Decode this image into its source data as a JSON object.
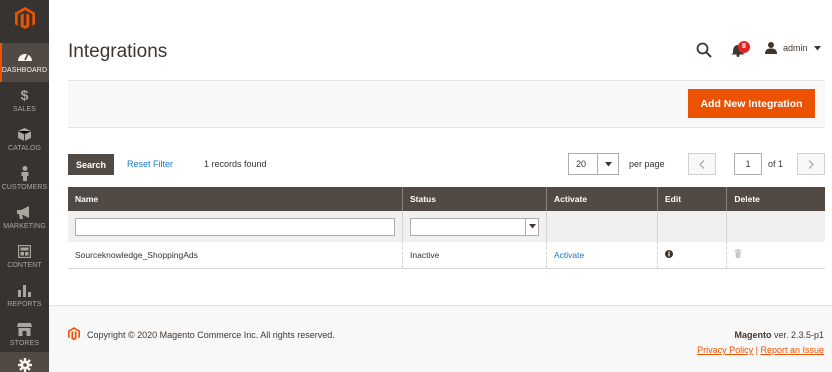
{
  "sidebar": {
    "items": [
      {
        "label": "DASHBOARD",
        "icon": "dashboard-icon"
      },
      {
        "label": "SALES",
        "icon": "dollar-icon"
      },
      {
        "label": "CATALOG",
        "icon": "cube-icon"
      },
      {
        "label": "CUSTOMERS",
        "icon": "person-icon"
      },
      {
        "label": "MARKETING",
        "icon": "megaphone-icon"
      },
      {
        "label": "CONTENT",
        "icon": "layout-icon"
      },
      {
        "label": "REPORTS",
        "icon": "bar-chart-icon"
      },
      {
        "label": "STORES",
        "icon": "store-icon"
      },
      {
        "label": "",
        "icon": "gear-icon"
      }
    ]
  },
  "header": {
    "title": "Integrations",
    "notifications_count": "8",
    "user": "admin"
  },
  "actions": {
    "add_new": "Add New Integration"
  },
  "grid": {
    "search_label": "Search",
    "reset_label": "Reset Filter",
    "records_found": "1 records found",
    "per_page_value": "20",
    "per_page_label": "per page",
    "page_value": "1",
    "page_of": "of 1",
    "columns": [
      "Name",
      "Status",
      "Activate",
      "Edit",
      "Delete"
    ],
    "rows": [
      {
        "name": "Sourceknowledge_ShoppingAds",
        "status": "Inactive",
        "activate": "Activate"
      }
    ]
  },
  "footer": {
    "copyright": "Copyright © 2020 Magento Commerce Inc. All rights reserved.",
    "product": "Magento",
    "version": " ver. 2.3.5-p1",
    "privacy": "Privacy Policy",
    "separator": " | ",
    "report": "Report an Issue"
  },
  "colors": {
    "accent": "#eb5202",
    "sidebar_bg": "#373330",
    "header_bg": "#514943",
    "link": "#1979c3"
  }
}
